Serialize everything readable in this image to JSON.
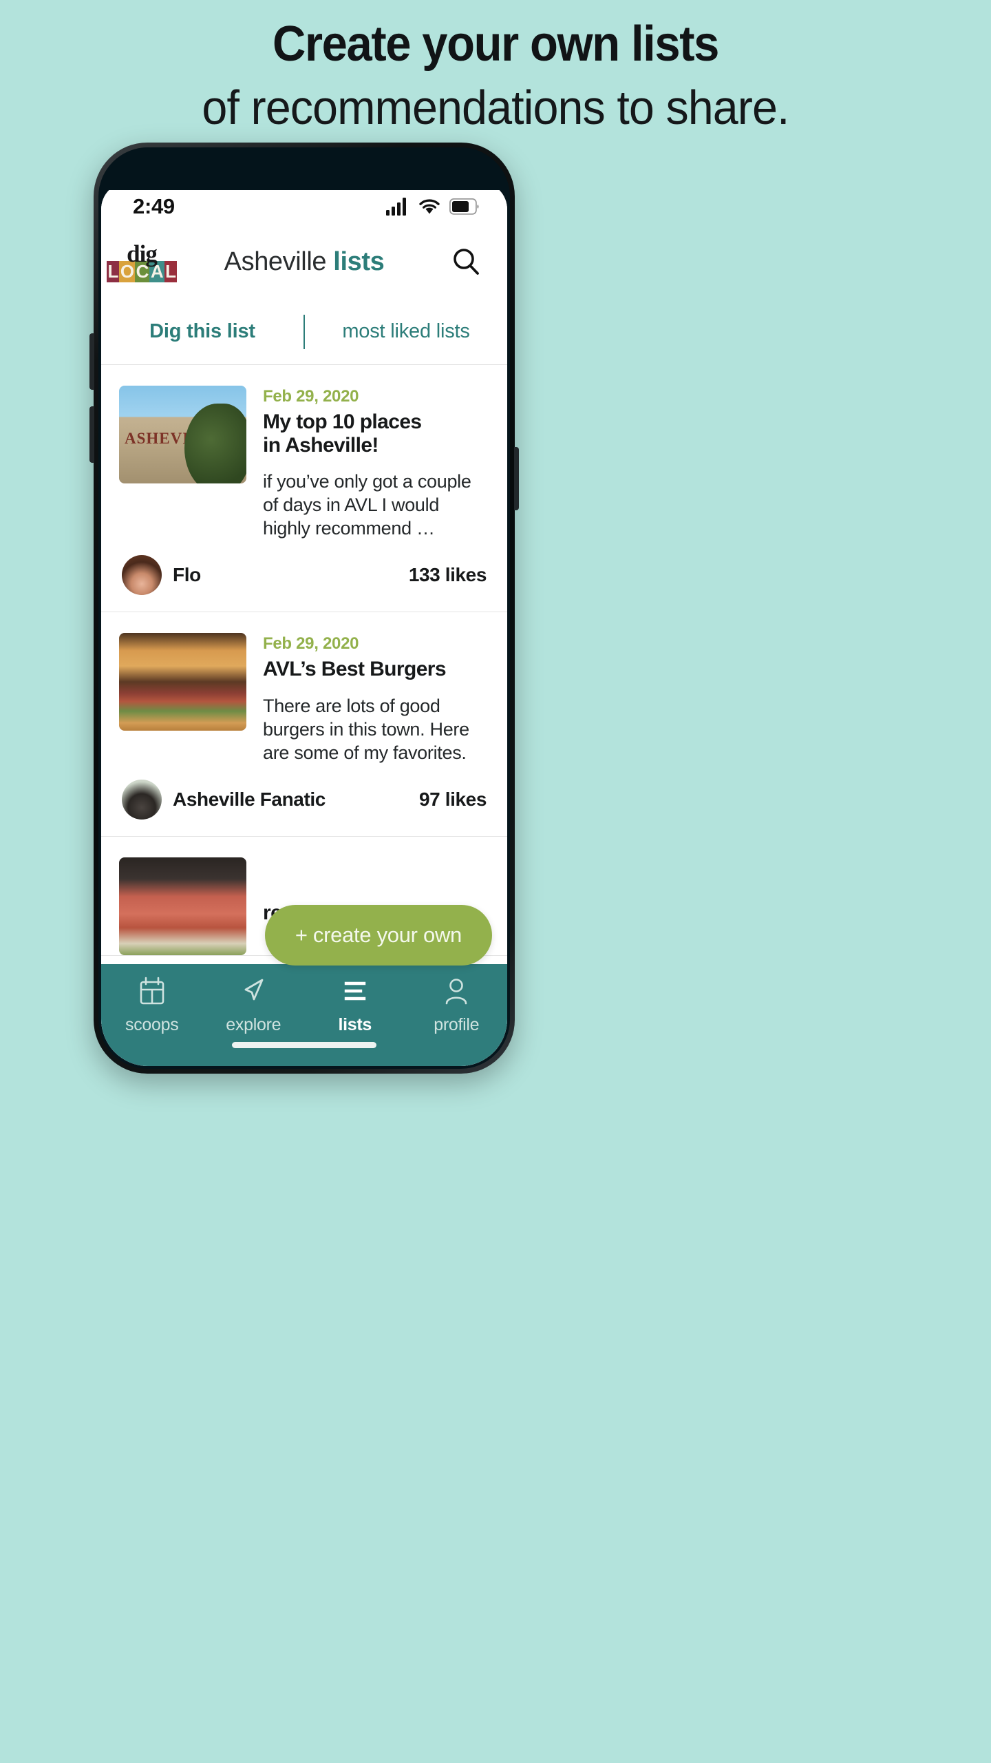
{
  "promo": {
    "line1": "Create your own lists",
    "line2": "of recommendations to share.",
    "background_color": "#b3e3dc"
  },
  "phone": {
    "status_bar": {
      "time": "2:49",
      "icons": [
        "cellular-signal-icon",
        "wifi-icon",
        "battery-icon"
      ]
    },
    "home_indicator": "home-indicator"
  },
  "app_header": {
    "logo": {
      "top_word": "dig",
      "bottom_word": "LOCAL",
      "bottom_letters": [
        "L",
        "O",
        "C",
        "A",
        "L"
      ],
      "letter_colors": [
        "#8d2f44",
        "#d9a23d",
        "#6b8f3b",
        "#3f8f8a",
        "#9a2f3c"
      ]
    },
    "title_regular": "Asheville ",
    "title_bold": "lists",
    "accent_color": "#2c7d79",
    "search_icon": "search-icon"
  },
  "tabs": [
    {
      "label": "Dig this list",
      "active": true
    },
    {
      "label": "most liked lists",
      "active": false
    }
  ],
  "lists": [
    {
      "date": "Feb 29, 2020",
      "title": "My top 10 places\n in Asheville!",
      "title_line1": "My top 10 places",
      "title_line2": " in Asheville!",
      "description": "if you’ve only got a couple of days in AVL I would highly recommend …",
      "author": "Flo",
      "likes": "133 likes",
      "thumb": "asheville-building-photo",
      "avatar": "flo-avatar"
    },
    {
      "date": "Feb 29, 2020",
      "title": "AVL’s Best Burgers",
      "title_line1": "AVL’s Best Burgers",
      "title_line2": "",
      "description": "There are lots of good burgers in this town. Here are some of my favorites.",
      "author": "Asheville Fanatic",
      "likes": "97 likes",
      "thumb": "burger-photo",
      "avatar": "asheville-fanatic-avatar"
    },
    {
      "date": "",
      "title": "restaurant musts",
      "title_line1": "restaurant musts",
      "title_line2": "",
      "description": "",
      "author": "",
      "likes": "",
      "thumb": "charcuterie-photo",
      "avatar": ""
    }
  ],
  "fab": {
    "label": "+ create your own",
    "color": "#93b14c"
  },
  "bottom_nav": {
    "background_color": "#2f7d7c",
    "items": [
      {
        "label": "scoops",
        "icon": "calendar-icon",
        "active": false
      },
      {
        "label": "explore",
        "icon": "navigation-arrow-icon",
        "active": false
      },
      {
        "label": "lists",
        "icon": "list-lines-icon",
        "active": true
      },
      {
        "label": "profile",
        "icon": "person-icon",
        "active": false
      }
    ]
  },
  "colors": {
    "date_green": "#93b14c",
    "teal": "#2c7d79",
    "nav_teal": "#2f7d7c"
  }
}
